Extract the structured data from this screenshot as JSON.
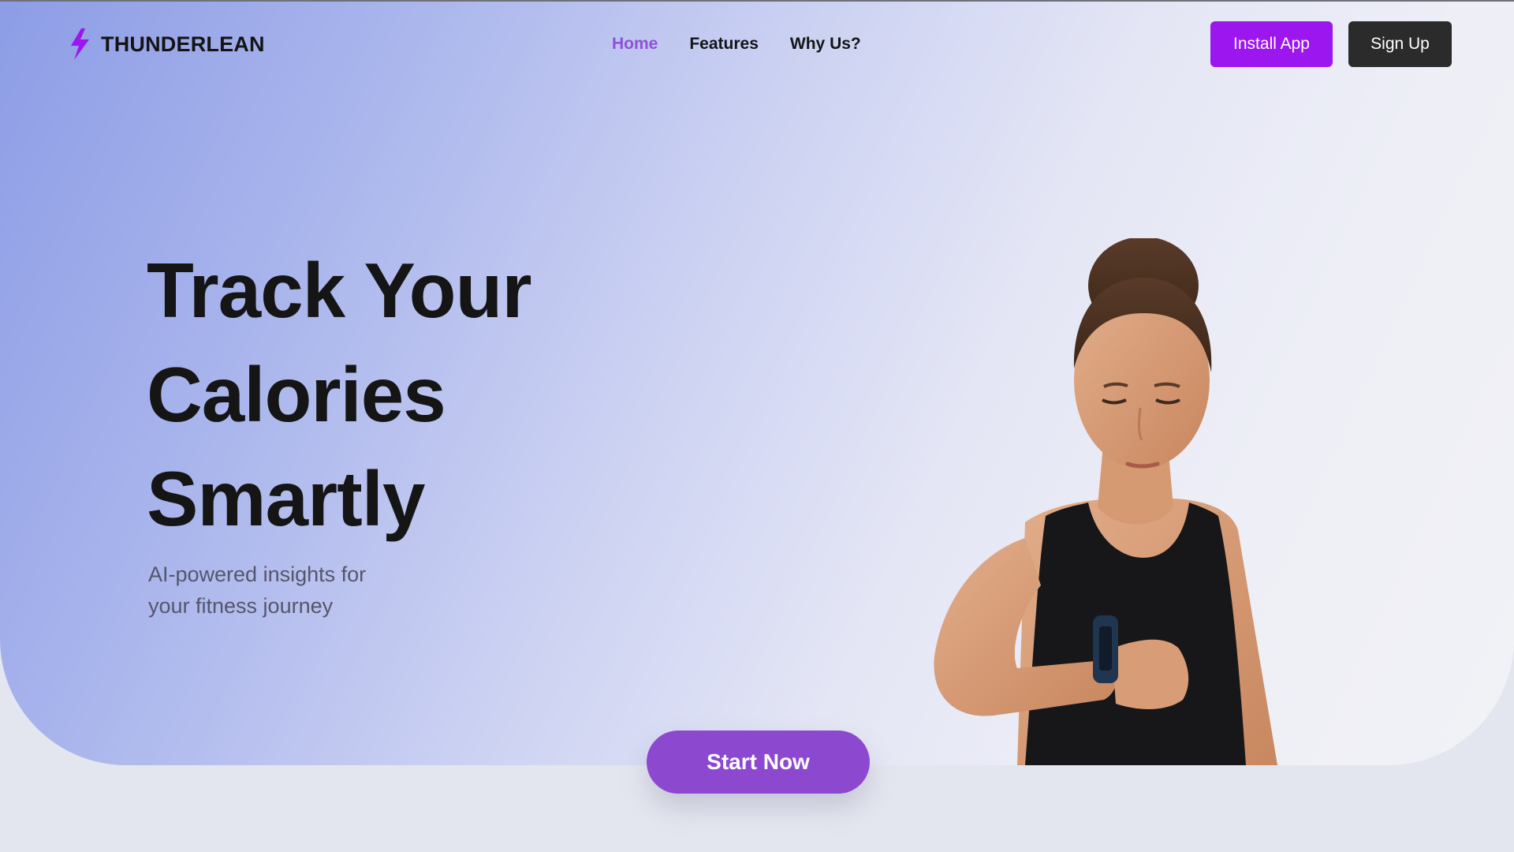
{
  "brand": {
    "name": "THUNDERLEAN",
    "icon": "lightning-bolt-icon",
    "accent_color": "#9b16ef"
  },
  "nav": {
    "links": [
      {
        "label": "Home",
        "active": true
      },
      {
        "label": "Features",
        "active": false
      },
      {
        "label": "Why Us?",
        "active": false
      }
    ],
    "active_color": "#8e52d6"
  },
  "actions": {
    "install_label": "Install App",
    "install_color": "#9b16ef",
    "signup_label": "Sign Up",
    "signup_color": "#2b2b2b"
  },
  "hero": {
    "headline_lines": [
      "Track Your",
      "Calories",
      "Smartly"
    ],
    "subtitle_lines": [
      "AI-powered insights for",
      "your fitness journey"
    ],
    "cta_label": "Start Now",
    "cta_color": "#8c49cf"
  }
}
